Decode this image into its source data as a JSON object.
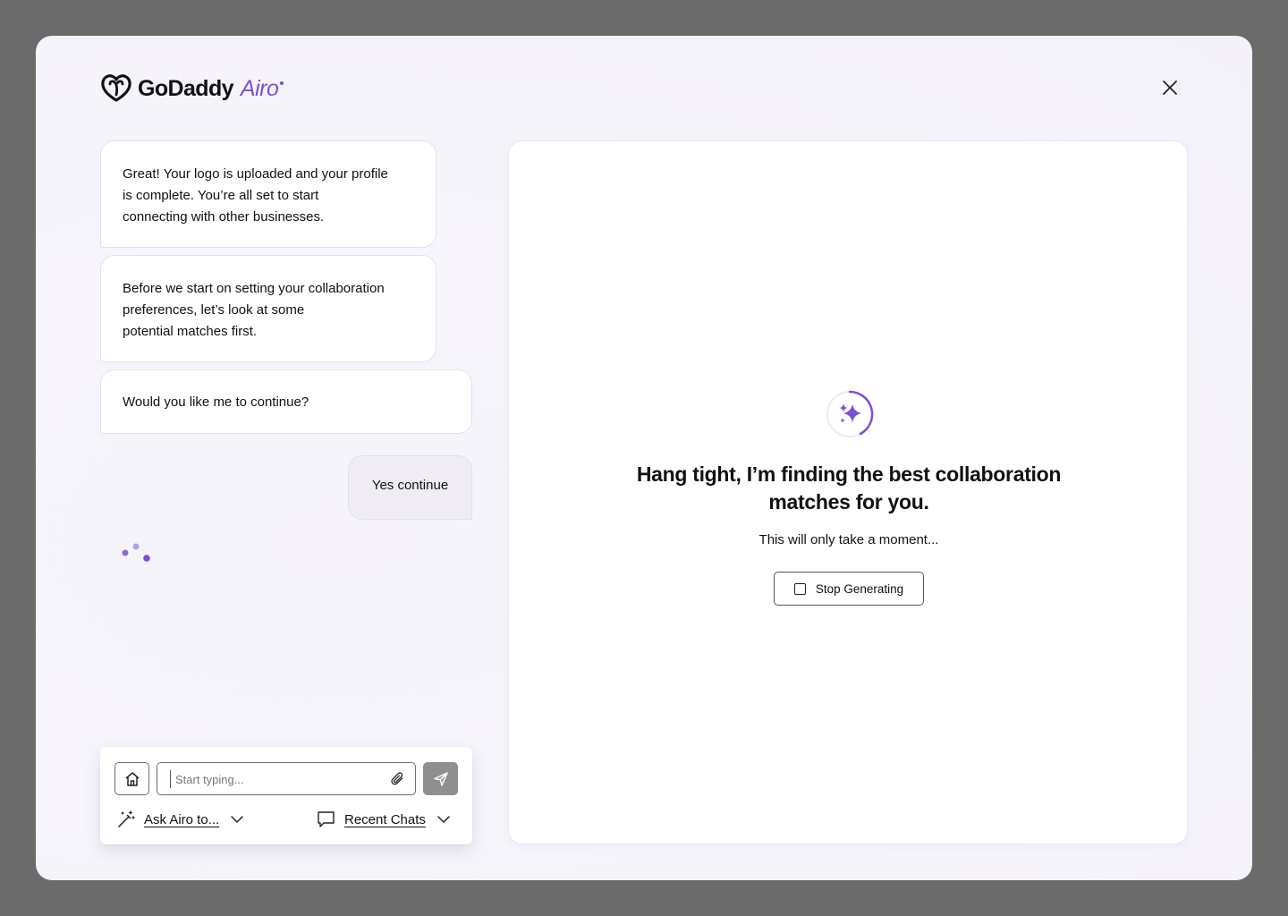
{
  "brand": {
    "name": "GoDaddy",
    "product": "Airo",
    "accent": "#7b4fd6"
  },
  "chat": {
    "messages": [
      {
        "lines": [
          "Great! Your logo is uploaded and your profile",
          "is complete. You’re all set to start",
          "connecting with other businesses."
        ]
      },
      {
        "lines": [
          "Before we start on setting your collaboration",
          "preferences, let’s look at some",
          "potential matches first."
        ]
      },
      {
        "lines": [
          "Would you like me to continue?"
        ]
      }
    ],
    "user_reply": "Yes continue"
  },
  "composer": {
    "placeholder": "Start typing...",
    "ask_label": "Ask Airo to...",
    "recent_label": "Recent Chats"
  },
  "panel": {
    "heading_lines": [
      "Hang tight, I’m finding the best collaboration",
      "matches for you."
    ],
    "subtext": "This will only take a moment...",
    "stop_label": "Stop Generating"
  },
  "icons": [
    "godaddy-logo-icon",
    "close-icon",
    "typing-indicator-icon",
    "home-icon",
    "paperclip-icon",
    "send-icon",
    "magic-wand-icon",
    "chevron-down-icon",
    "chat-bubble-icon",
    "sparkle-spinner-icon",
    "stop-square-icon"
  ]
}
